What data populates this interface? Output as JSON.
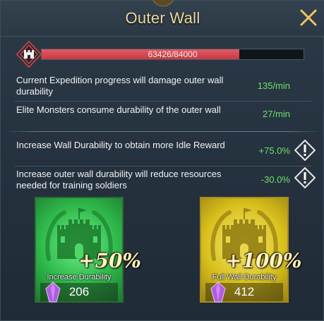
{
  "title": "Outer Wall",
  "icons": {
    "close": "close-x-icon",
    "wall": "wall-shield-icon",
    "warning": "warning-icon",
    "gem": "purple-gem-icon"
  },
  "durability": {
    "current": 63426,
    "max": 84000,
    "text": "63426/84000"
  },
  "rates": [
    {
      "text": "Current Expedition progress will damage outer wall durability",
      "value": "135/min"
    },
    {
      "text": "Elite Monsters consume durability of the outer wall",
      "value": "27/min"
    }
  ],
  "effects": [
    {
      "text": "Increase Wall Durability to obtain more Idle Reward",
      "value": "+75.0%"
    },
    {
      "text": "Increase outer wall durability will reduce resources needed for training soldiers",
      "value": "-30.0%"
    }
  ],
  "options": [
    {
      "percent": "+50%",
      "label": "Increase Durability",
      "cost": "206"
    },
    {
      "percent": "+100%",
      "label": "Full Wall Durability",
      "cost": "412"
    }
  ],
  "colors": {
    "title": "#f0d9a0",
    "hp_fill": "#d8474f",
    "positive": "#6fe06c",
    "green_card": "#2fb84a",
    "gold_card": "#d9c11d",
    "gem": "#b05ce0"
  }
}
